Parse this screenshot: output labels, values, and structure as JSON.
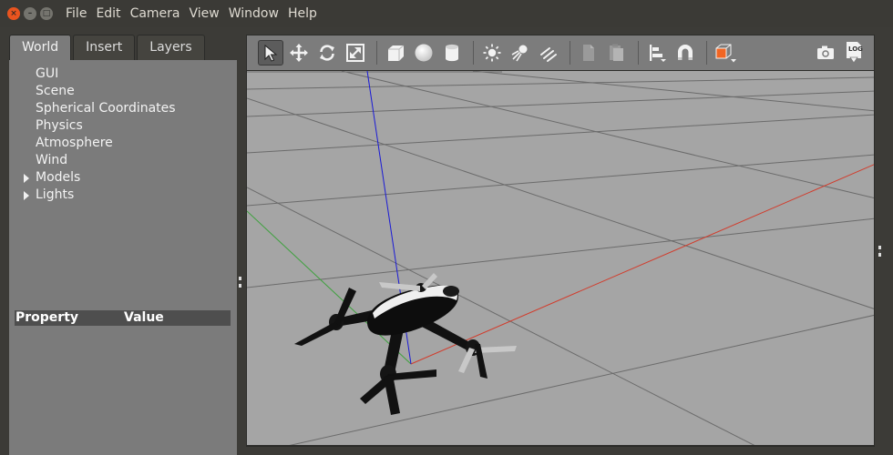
{
  "menubar": {
    "window_buttons": {
      "close": "×",
      "minimize": "–",
      "maximize": "□"
    },
    "items": [
      "File",
      "Edit",
      "Camera",
      "View",
      "Window",
      "Help"
    ]
  },
  "left_panel": {
    "tabs": [
      {
        "label": "World",
        "active": true
      },
      {
        "label": "Insert",
        "active": false
      },
      {
        "label": "Layers",
        "active": false
      }
    ],
    "tree_items": [
      {
        "label": "GUI",
        "expandable": false
      },
      {
        "label": "Scene",
        "expandable": false
      },
      {
        "label": "Spherical Coordinates",
        "expandable": false
      },
      {
        "label": "Physics",
        "expandable": false
      },
      {
        "label": "Atmosphere",
        "expandable": false
      },
      {
        "label": "Wind",
        "expandable": false
      },
      {
        "label": "Models",
        "expandable": true
      },
      {
        "label": "Lights",
        "expandable": true
      }
    ],
    "property_table": {
      "columns": [
        "Property",
        "Value"
      ]
    }
  },
  "toolbar": {
    "tools": [
      {
        "name": "select-mode-icon",
        "active": true
      },
      {
        "name": "translate-mode-icon",
        "active": false
      },
      {
        "name": "rotate-mode-icon",
        "active": false
      },
      {
        "name": "scale-mode-icon",
        "active": false
      },
      {
        "name": "box-shape-icon",
        "active": false
      },
      {
        "name": "sphere-shape-icon",
        "active": false
      },
      {
        "name": "cylinder-shape-icon",
        "active": false
      },
      {
        "name": "point-light-icon",
        "active": false
      },
      {
        "name": "spot-light-icon",
        "active": false
      },
      {
        "name": "directional-light-icon",
        "active": false
      },
      {
        "name": "copy-icon",
        "active": false
      },
      {
        "name": "paste-icon",
        "active": false
      },
      {
        "name": "align-icon",
        "active": false
      },
      {
        "name": "snap-icon",
        "active": false
      },
      {
        "name": "view-angle-icon",
        "active": false
      },
      {
        "name": "screenshot-icon",
        "active": false
      },
      {
        "name": "log-icon",
        "active": false
      }
    ],
    "log_label": "LOG",
    "colors": {
      "accent_orange": "#f26522",
      "icon_white": "#f2f2f2"
    }
  },
  "viewport": {
    "background": "#a5a5a5",
    "axis_colors": {
      "x": "#d23b2b",
      "y": "#3ea13e",
      "z": "#1a1ad6"
    }
  }
}
